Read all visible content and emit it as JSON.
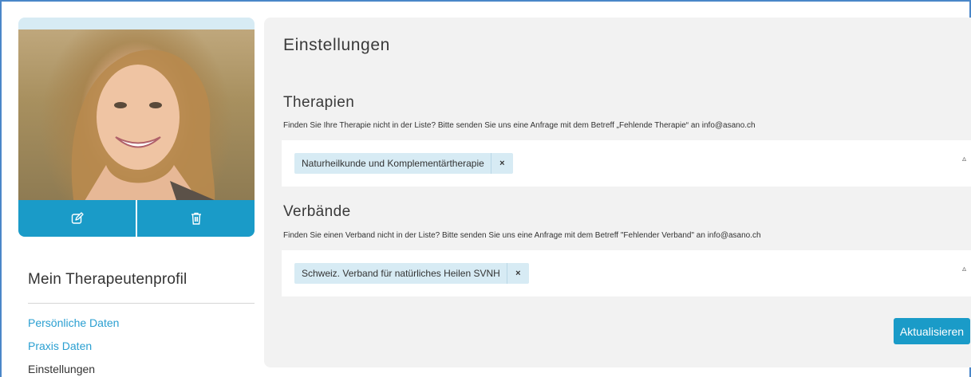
{
  "profile_card": {
    "edit_icon": "edit-icon",
    "delete_icon": "trash-icon"
  },
  "sidebar": {
    "title": "Mein Therapeutenprofil",
    "items": [
      {
        "label": "Persönliche Daten",
        "active": false
      },
      {
        "label": "Praxis Daten",
        "active": false
      },
      {
        "label": "Einstellungen",
        "active": true
      }
    ]
  },
  "main": {
    "title": "Einstellungen",
    "therapies": {
      "heading": "Therapien",
      "hint": "Finden Sie Ihre Therapie nicht in der Liste? Bitte senden Sie uns eine Anfrage mit dem Betreff „Fehlende Therapie“ an info@asano.ch",
      "selected": [
        "Naturheilkunde und Komplementärtherapie"
      ],
      "remove_symbol": "×",
      "caret": "▵"
    },
    "associations": {
      "heading": "Verbände",
      "hint": "Finden Sie einen Verband nicht in der Liste? Bitte senden Sie uns eine Anfrage mit dem Betreff \"Fehlender Verband\" an info@asano.ch",
      "selected": [
        "Schweiz. Verband für natürliches Heilen SVNH"
      ],
      "remove_symbol": "×",
      "caret": "▵"
    },
    "update_button": "Aktualisieren"
  },
  "colors": {
    "accent": "#1a9bc8",
    "link": "#2a9fd1",
    "tag_bg": "#d7ebf4",
    "panel_bg": "#f2f2f2"
  }
}
